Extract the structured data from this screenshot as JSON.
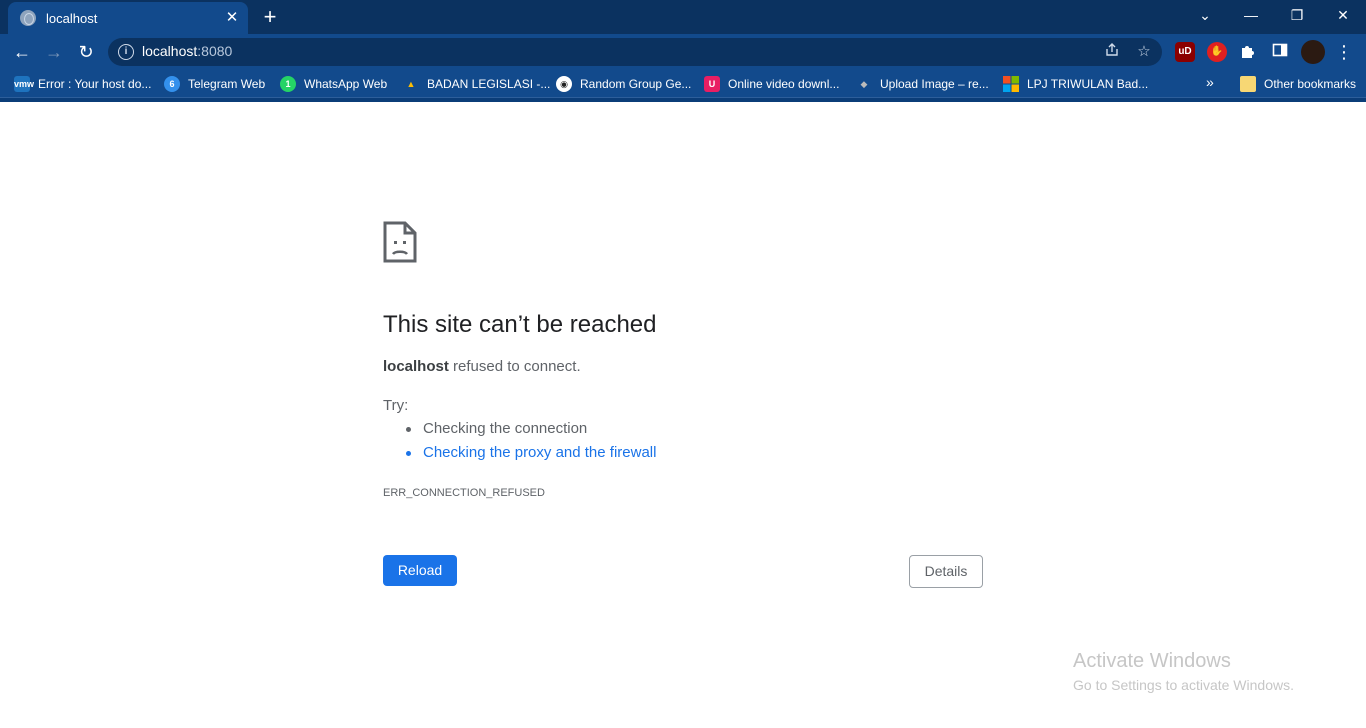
{
  "tab": {
    "title": "localhost",
    "close": "✕",
    "new_tab": "+"
  },
  "window_controls": {
    "dropdown": "⌄",
    "minimize": "—",
    "restore": "❐",
    "close": "✕"
  },
  "toolbar": {
    "back": "←",
    "forward": "→",
    "reload": "↻",
    "url_host": "localhost",
    "url_port": ":8080",
    "share_icon": "share-icon",
    "star_icon": "star-icon",
    "menu": "⋮"
  },
  "extensions": [
    {
      "label": "uD",
      "color": "#8b0000"
    },
    {
      "label": "✋",
      "color": "#e02020"
    },
    {
      "label": "puzzle",
      "color": "transparent"
    },
    {
      "label": "sidepanel",
      "color": "transparent"
    }
  ],
  "bookmarks": [
    {
      "label": "Error : Your host do...",
      "icon_text": "vmw",
      "icon_color": "#1e73be"
    },
    {
      "label": "Telegram Web",
      "icon_text": "6",
      "icon_color": "#3390ec"
    },
    {
      "label": "WhatsApp Web",
      "icon_text": "1",
      "icon_color": "#25d366"
    },
    {
      "label": "BADAN LEGISLASI -...",
      "icon_text": "▲",
      "icon_color": "#1fa463"
    },
    {
      "label": "Random Group Ge...",
      "icon_text": "◉",
      "icon_color": "#222222"
    },
    {
      "label": "Online video downl...",
      "icon_text": "U",
      "icon_color": "#e91e63"
    },
    {
      "label": "Upload Image – re...",
      "icon_text": "◆",
      "icon_color": "#777777"
    },
    {
      "label": "LPJ TRIWULAN Bad...",
      "icon_text": "▦",
      "icon_color": "#f25022"
    }
  ],
  "bookmarks_overflow": "»",
  "other_bookmarks": "Other bookmarks",
  "error_page": {
    "heading": "This site can’t be reached",
    "host": "localhost",
    "message_suffix": " refused to connect.",
    "try_label": "Try:",
    "suggestions": [
      "Checking the connection",
      "Checking the proxy and the firewall"
    ],
    "error_code": "ERR_CONNECTION_REFUSED",
    "reload_label": "Reload",
    "details_label": "Details"
  },
  "watermark": {
    "line1": "Activate Windows",
    "line2": "Go to Settings to activate Windows."
  }
}
